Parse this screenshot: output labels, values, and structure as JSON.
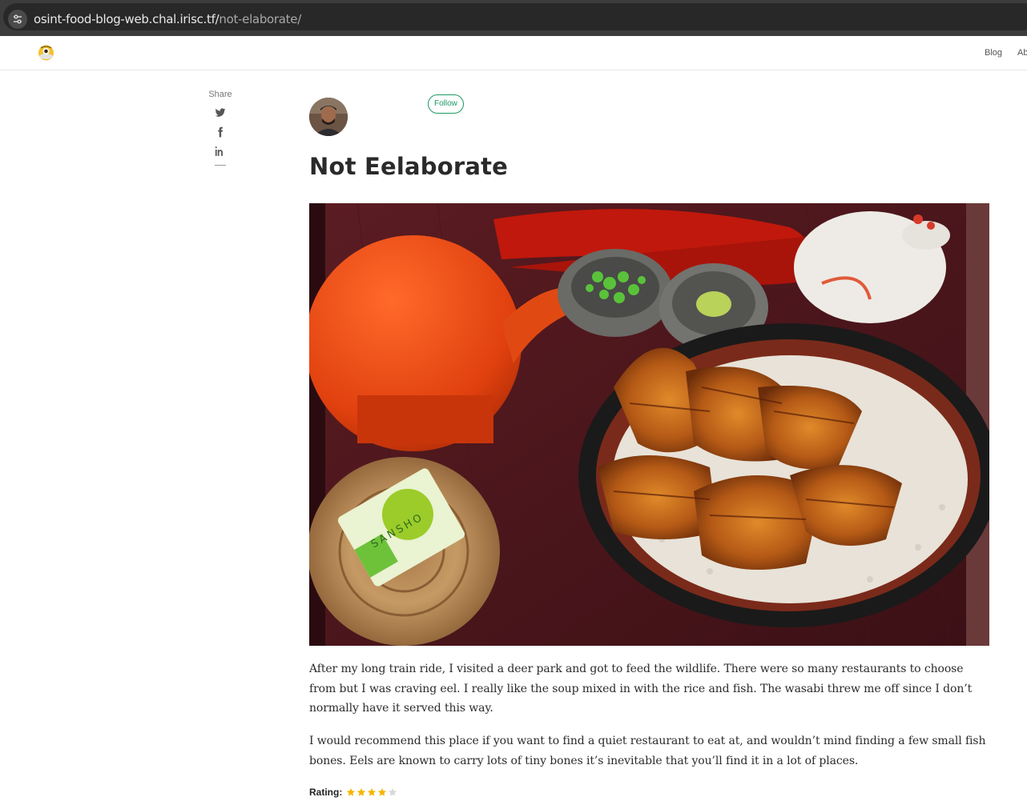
{
  "browser": {
    "url_host": "osint-food-blog-web.chal.irisc.tf/",
    "url_path": "not-elaborate/",
    "site_info_icon": "tune-icon"
  },
  "header": {
    "logo_icon": "emoji-logo-icon",
    "nav": [
      {
        "label": "Blog"
      },
      {
        "label": "Ab"
      }
    ]
  },
  "share": {
    "label": "Share",
    "icons": [
      "twitter-icon",
      "facebook-icon",
      "linkedin-icon"
    ]
  },
  "author": {
    "avatar_icon": "avatar",
    "follow_label": "Follow",
    "accent": "#1c9963"
  },
  "post": {
    "title": "Not Eelaborate",
    "paragraphs": [
      "After my long train ride, I visited a deer park and got to feed the wildlife. There were so many restaurants to choose from but I was craving eel. I really like the soup mixed in with the rice and fish. The wasabi threw me off since I don’t normally have it served this way.",
      "I would recommend this place if you want to find a quiet restaurant to eat at, and wouldn’t mind finding a few small fish bones. Eels are known to carry lots of tiny bones it’s inevitable that you’ll find it in a lot of places."
    ],
    "rating_label": "Rating:",
    "rating_value": 4,
    "rating_max": 5,
    "star_color": "#f5b400",
    "star_empty_color": "#d8d8d8"
  }
}
